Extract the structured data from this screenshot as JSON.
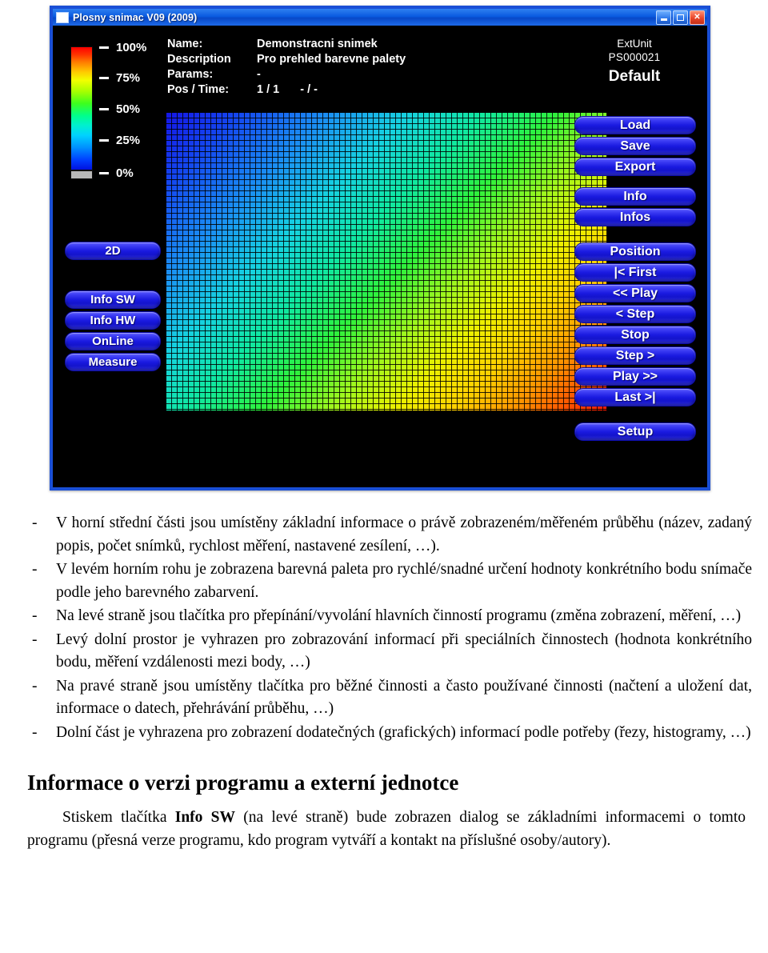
{
  "window": {
    "title": "Plosny snimac V09 (2009)",
    "controls": {
      "minimize": "minimize-button",
      "maximize": "maximize-button",
      "close": "close-button"
    }
  },
  "palette": {
    "ticks": [
      {
        "label": "100%"
      },
      {
        "label": "75%"
      },
      {
        "label": "50%"
      },
      {
        "label": "25%"
      },
      {
        "label": "0%"
      }
    ],
    "gradient_top_color": "#ff0000",
    "gradient_bottom_color": "#0010e0",
    "zero_color": "#b8b8b8"
  },
  "info": {
    "rows": [
      {
        "label": "Name:",
        "value": "Demonstracni snimek"
      },
      {
        "label": "Description",
        "value": "Pro prehled barevne palety"
      },
      {
        "label": "Params:",
        "value": "-"
      }
    ],
    "pos_label": "Pos / Time:",
    "pos_value": "1 / 1",
    "time_value": "- / -"
  },
  "ext_unit": {
    "line1": "ExtUnit",
    "line2": "PS000021",
    "profile": "Default"
  },
  "left_buttons": [
    {
      "label": "2D",
      "name": "button-2d"
    },
    {
      "label": "Info SW",
      "name": "button-info-sw"
    },
    {
      "label": "Info HW",
      "name": "button-info-hw"
    },
    {
      "label": "OnLine",
      "name": "button-online"
    },
    {
      "label": "Measure",
      "name": "button-measure"
    }
  ],
  "right_buttons": [
    {
      "label": "Load",
      "name": "button-load"
    },
    {
      "label": "Save",
      "name": "button-save"
    },
    {
      "label": "Export",
      "name": "button-export"
    },
    {
      "label": "Info",
      "name": "button-info"
    },
    {
      "label": "Infos",
      "name": "button-infos"
    },
    {
      "label": "Position",
      "name": "button-position"
    },
    {
      "label": "|< First",
      "name": "button-first"
    },
    {
      "label": "<< Play",
      "name": "button-play-back"
    },
    {
      "label": "< Step",
      "name": "button-step-back"
    },
    {
      "label": "Stop",
      "name": "button-stop"
    },
    {
      "label": "Step >",
      "name": "button-step-forward"
    },
    {
      "label": "Play >>",
      "name": "button-play-forward"
    },
    {
      "label": "Last >|",
      "name": "button-last"
    },
    {
      "label": "Setup",
      "name": "button-setup"
    }
  ],
  "document": {
    "bullets": [
      {
        "dash": "-",
        "text": "V horní střední části jsou umístěny základní informace o právě zobrazeném/měřeném průběhu (název, zadaný popis, počet snímků, rychlost měření, nastavené zesílení, …)."
      },
      {
        "dash": "-",
        "text": "V levém horním rohu je zobrazena barevná paleta pro rychlé/snadné určení hodnoty konkrétního bodu snímače podle jeho barevného zabarvení."
      },
      {
        "dash": "-",
        "text": "Na levé straně jsou tlačítka pro přepínání/vyvolání hlavních činností programu (změna zobrazení, měření, …)"
      },
      {
        "dash": "-",
        "text": "Levý dolní prostor je vyhrazen pro zobrazování informací při speciálních činnostech (hodnota konkrétního bodu, měření vzdálenosti mezi body, …)"
      },
      {
        "dash": "-",
        "text": "Na pravé straně jsou umístěny tlačítka pro běžné činnosti a často používané činnosti (načtení a uložení dat, informace o datech, přehrávání průběhu, …)"
      },
      {
        "dash": "-",
        "text": "Dolní část je vyhrazena pro zobrazení dodatečných (grafických) informací podle potřeby (řezy, histogramy, …)"
      }
    ],
    "heading": "Informace o verzi programu a externí jednotce",
    "paragraph_part1": "Stiskem tlačítka ",
    "paragraph_bold": "Info SW",
    "paragraph_part2": " (na levé straně) bude zobrazen dialog se základními informacemi o tomto programu (přesná verze programu, kdo program vytváří a kontakt na příslušné osoby/autory)."
  }
}
